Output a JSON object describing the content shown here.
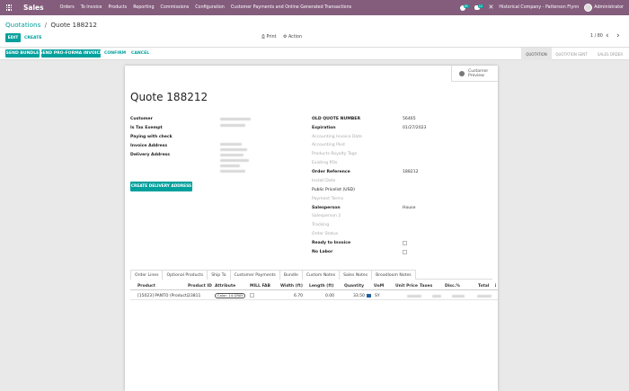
{
  "navbar": {
    "app_name": "Sales",
    "menu": [
      "Orders",
      "To Invoice",
      "Products",
      "Reporting",
      "Commissions",
      "Configuration",
      "Customer Payments and Online Generated Transactions"
    ],
    "chat_badge": "85",
    "activity_badge": "12",
    "company": "Historical Company - Patterson Flynn",
    "user": "Administrator"
  },
  "control_panel": {
    "breadcrumb_parent": "Quotations",
    "breadcrumb_separator": "/",
    "breadcrumb_current": "Quote 188212",
    "edit_label": "EDIT",
    "create_label": "CREATE",
    "print_label": "Print",
    "action_label": "Action",
    "pager": "1 / 80"
  },
  "statusbar": {
    "buttons": [
      "SEND BUNDLE",
      "SEND PRO-FORMA INVOICE",
      "CONFIRM",
      "CANCEL"
    ],
    "stages": [
      "QUOTATION",
      "QUOTATION SENT",
      "SALES ORDER"
    ],
    "active_stage": "QUOTATION"
  },
  "sheet": {
    "preview_label": "Customer Preview",
    "title": "Quote 188212",
    "left_fields": [
      "Customer",
      "Is Tax Exempt",
      "Paying with check",
      "Invoice Address",
      "Delivery Address"
    ],
    "create_delivery_label": "CREATE DELIVERY ADDRESS",
    "right_fields": [
      {
        "label": "OLD QUOTE NUMBER",
        "value": "56465",
        "muted": false
      },
      {
        "label": "Expiration",
        "value": "01/27/2023",
        "muted": false
      },
      {
        "label": "Accounting Invoice Date",
        "value": "",
        "muted": true
      },
      {
        "label": "Accounting Paid",
        "value": "",
        "muted": true
      },
      {
        "label": "Products Royalty Tags",
        "value": "",
        "muted": true
      },
      {
        "label": "Existing POs",
        "value": "",
        "muted": true
      },
      {
        "label": "Order Reference",
        "value": "188212",
        "muted": false
      },
      {
        "label": "Install Date",
        "value": "",
        "muted": true
      },
      {
        "label": "Public Pricelist (USD)",
        "value": "",
        "muted": false
      },
      {
        "label": "Payment Terms",
        "value": "",
        "muted": true
      },
      {
        "label": "Salesperson",
        "value": "House",
        "muted": false
      },
      {
        "label": "Salesperson 2",
        "value": "",
        "muted": true
      },
      {
        "label": "Tracking",
        "value": "",
        "muted": true
      },
      {
        "label": "Order Status",
        "value": "",
        "muted": true
      },
      {
        "label": "Ready to Invoice",
        "value": "",
        "muted": false
      },
      {
        "label": "No Labor",
        "value": "",
        "muted": false
      }
    ]
  },
  "tabs": [
    "Order Lines",
    "Optional Products",
    "Ship To",
    "Customer Payments",
    "Bundle",
    "Custom Notes",
    "Sales Notes",
    "Broadloom Notes"
  ],
  "order_lines": {
    "columns": [
      "Product",
      "Product ID",
      "Attribute",
      "MILL FAB",
      "Width (ft)",
      "Length (ft)",
      "Quantity",
      "UoM",
      "Unit Price",
      "Taxes",
      "Disc.%",
      "Total"
    ],
    "rows": [
      {
        "product": "[15023] PANTO (Product)",
        "product_id": "23811",
        "attribute": "Color: 14 GRAY",
        "width": "6.70",
        "length": "0.00",
        "quantity": "33.50",
        "uom": "SY"
      }
    ]
  },
  "icons": {
    "apps": "apps-grid-icon",
    "chat": "chat-icon",
    "activity": "activity-icon",
    "close": "close-icon",
    "print": "print-icon",
    "action": "gear-icon",
    "globe": "globe-icon",
    "truck": "truck-icon"
  },
  "colors": {
    "navbar": "#845d7d",
    "primary": "#00a09d"
  }
}
